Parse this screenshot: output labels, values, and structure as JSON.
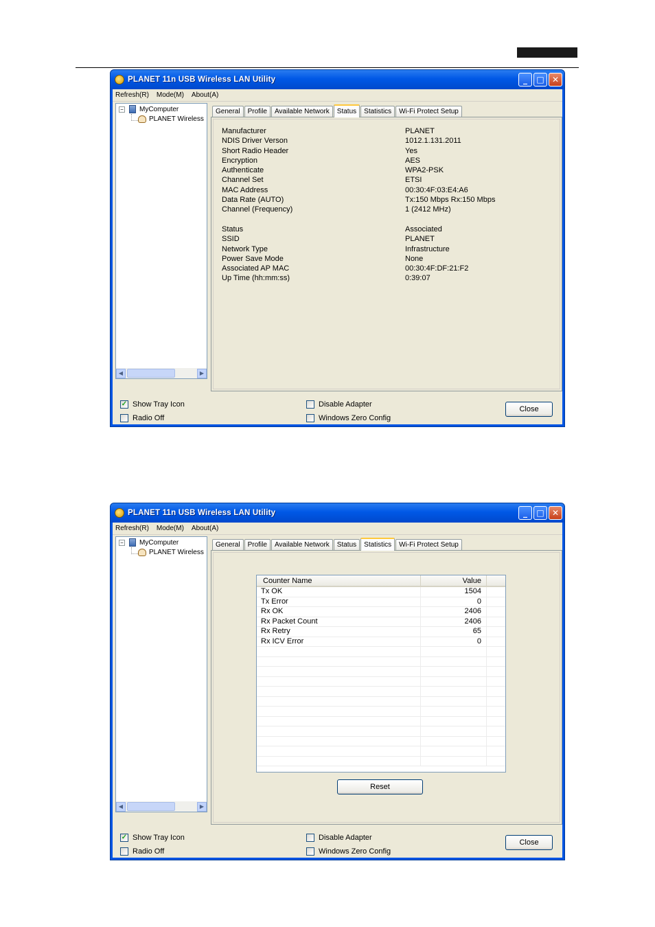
{
  "windows": [
    {
      "title": "PLANET 11n USB Wireless LAN Utility",
      "menu": [
        "Refresh(R)",
        "Mode(M)",
        "About(A)"
      ],
      "tree": {
        "root": "MyComputer",
        "child": "PLANET Wireless"
      },
      "tabs": [
        "General",
        "Profile",
        "Available Network",
        "Status",
        "Statistics",
        "Wi-Fi Protect Setup"
      ],
      "active_tab": "Status",
      "status": {
        "group1": [
          {
            "label": "Manufacturer",
            "value": "PLANET"
          },
          {
            "label": "NDIS Driver Verson",
            "value": "1012.1.131.2011"
          },
          {
            "label": "Short Radio Header",
            "value": "Yes"
          },
          {
            "label": "Encryption",
            "value": "AES"
          },
          {
            "label": "Authenticate",
            "value": "WPA2-PSK"
          },
          {
            "label": "Channel Set",
            "value": "ETSI"
          },
          {
            "label": "MAC Address",
            "value": "00:30:4F:03:E4:A6"
          },
          {
            "label": "Data Rate (AUTO)",
            "value": "Tx:150 Mbps Rx:150 Mbps"
          },
          {
            "label": "Channel (Frequency)",
            "value": "1 (2412 MHz)"
          }
        ],
        "group2": [
          {
            "label": "Status",
            "value": "Associated"
          },
          {
            "label": "SSID",
            "value": "PLANET"
          },
          {
            "label": "Network Type",
            "value": "Infrastructure"
          },
          {
            "label": "Power Save Mode",
            "value": "None"
          },
          {
            "label": "Associated AP MAC",
            "value": "00:30:4F:DF:21:F2"
          },
          {
            "label": "Up Time (hh:mm:ss)",
            "value": "0:39:07"
          }
        ]
      },
      "bottom": {
        "show_tray_icon": "Show Tray Icon",
        "radio_off": "Radio Off",
        "disable_adapter": "Disable Adapter",
        "windows_zero_config": "Windows Zero Config",
        "close": "Close"
      }
    },
    {
      "title": "PLANET 11n USB Wireless LAN Utility",
      "menu": [
        "Refresh(R)",
        "Mode(M)",
        "About(A)"
      ],
      "tree": {
        "root": "MyComputer",
        "child": "PLANET Wireless"
      },
      "tabs": [
        "General",
        "Profile",
        "Available Network",
        "Status",
        "Statistics",
        "Wi-Fi Protect Setup"
      ],
      "active_tab": "Statistics",
      "statistics": {
        "headers": [
          "Counter Name",
          "Value"
        ],
        "rows": [
          {
            "name": "Tx OK",
            "value": "1504"
          },
          {
            "name": "Tx Error",
            "value": "0"
          },
          {
            "name": "Rx OK",
            "value": "2406"
          },
          {
            "name": "Rx Packet Count",
            "value": "2406"
          },
          {
            "name": "Rx Retry",
            "value": "65"
          },
          {
            "name": "Rx ICV Error",
            "value": "0"
          }
        ],
        "reset": "Reset"
      },
      "bottom": {
        "show_tray_icon": "Show Tray Icon",
        "radio_off": "Radio Off",
        "disable_adapter": "Disable Adapter",
        "windows_zero_config": "Windows Zero Config",
        "close": "Close"
      }
    }
  ],
  "colors": {
    "titlebar": "#0054e3",
    "window_bg": "#ece9d8",
    "active_tab_accent": "#ffc83c"
  },
  "states": {
    "show_tray_icon": true,
    "radio_off": false,
    "disable_adapter": false,
    "windows_zero_config": false
  }
}
